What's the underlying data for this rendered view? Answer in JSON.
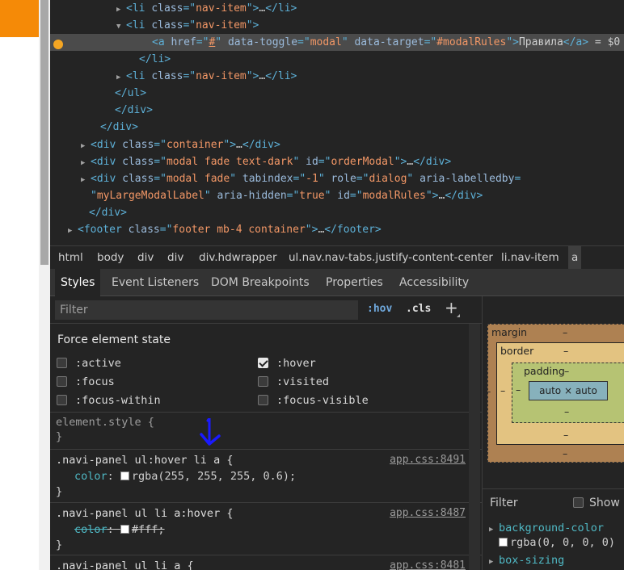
{
  "tree": {
    "lines": [
      {
        "t": "▶",
        "parts": [
          [
            "tag",
            "<li "
          ],
          [
            "attr",
            "class"
          ],
          [
            "tag",
            "=\""
          ],
          [
            "val",
            "nav-item"
          ],
          [
            "tag",
            "\">"
          ],
          [
            "txt",
            "…"
          ],
          [
            "tag",
            "</li>"
          ]
        ]
      },
      {
        "t": "▼",
        "parts": [
          [
            "tag",
            "<li "
          ],
          [
            "attr",
            "class"
          ],
          [
            "tag",
            "=\""
          ],
          [
            "val",
            "nav-item"
          ],
          [
            "tag",
            "\">"
          ]
        ]
      },
      {
        "t": "",
        "parts": [
          [
            "tag",
            "<a "
          ],
          [
            "attr",
            "href"
          ],
          [
            "tag",
            "=\""
          ],
          [
            "val",
            "#"
          ],
          [
            "tag",
            "\" "
          ],
          [
            "attr",
            "data-toggle"
          ],
          [
            "tag",
            "=\""
          ],
          [
            "val",
            "modal"
          ],
          [
            "tag",
            "\" "
          ],
          [
            "attr",
            "data-target"
          ],
          [
            "tag",
            "=\""
          ],
          [
            "val",
            "#modalRules"
          ],
          [
            "tag",
            "\">"
          ],
          [
            "txt",
            "Правила"
          ],
          [
            "tag",
            "</a>"
          ],
          [
            "txt",
            " = $0"
          ]
        ]
      },
      {
        "t": "",
        "parts": [
          [
            "tag",
            "</li>"
          ]
        ]
      },
      {
        "t": "▶",
        "parts": [
          [
            "tag",
            "<li "
          ],
          [
            "attr",
            "class"
          ],
          [
            "tag",
            "=\""
          ],
          [
            "val",
            "nav-item"
          ],
          [
            "tag",
            "\">"
          ],
          [
            "txt",
            "…"
          ],
          [
            "tag",
            "</li>"
          ]
        ]
      },
      {
        "t": "",
        "parts": [
          [
            "tag",
            "</ul>"
          ]
        ]
      },
      {
        "t": "",
        "parts": [
          [
            "tag",
            "</div>"
          ]
        ]
      },
      {
        "t": "",
        "parts": [
          [
            "tag",
            "</div>"
          ]
        ]
      },
      {
        "t": "▶",
        "parts": [
          [
            "tag",
            "<div "
          ],
          [
            "attr",
            "class"
          ],
          [
            "tag",
            "=\""
          ],
          [
            "val",
            "container"
          ],
          [
            "tag",
            "\">"
          ],
          [
            "txt",
            "…"
          ],
          [
            "tag",
            "</div>"
          ]
        ]
      },
      {
        "t": "▶",
        "parts": [
          [
            "tag",
            "<div "
          ],
          [
            "attr",
            "class"
          ],
          [
            "tag",
            "=\""
          ],
          [
            "val",
            "modal fade text-dark"
          ],
          [
            "tag",
            "\" "
          ],
          [
            "attr",
            "id"
          ],
          [
            "tag",
            "=\""
          ],
          [
            "val",
            "orderModal"
          ],
          [
            "tag",
            "\">"
          ],
          [
            "txt",
            "…"
          ],
          [
            "tag",
            "</div>"
          ]
        ]
      },
      {
        "t": "▶",
        "parts": [
          [
            "tag",
            "<div "
          ],
          [
            "attr",
            "class"
          ],
          [
            "tag",
            "=\""
          ],
          [
            "val",
            "modal fade"
          ],
          [
            "tag",
            "\" "
          ],
          [
            "attr",
            "tabindex"
          ],
          [
            "tag",
            "=\""
          ],
          [
            "val",
            "-1"
          ],
          [
            "tag",
            "\" "
          ],
          [
            "attr",
            "role"
          ],
          [
            "tag",
            "=\""
          ],
          [
            "val",
            "dialog"
          ],
          [
            "tag",
            "\" "
          ],
          [
            "attr",
            "aria-labelledby"
          ],
          [
            "tag",
            "="
          ]
        ]
      },
      {
        "t": "",
        "parts": [
          [
            "tag",
            "\""
          ],
          [
            "val",
            "myLargeModalLabel"
          ],
          [
            "tag",
            "\" "
          ],
          [
            "attr",
            "aria-hidden"
          ],
          [
            "tag",
            "=\""
          ],
          [
            "val",
            "true"
          ],
          [
            "tag",
            "\" "
          ],
          [
            "attr",
            "id"
          ],
          [
            "tag",
            "=\""
          ],
          [
            "val",
            "modalRules"
          ],
          [
            "tag",
            "\">"
          ],
          [
            "txt",
            "…"
          ],
          [
            "tag",
            "</div>"
          ]
        ]
      },
      {
        "t": "",
        "parts": [
          [
            "tag",
            "</div>"
          ]
        ]
      },
      {
        "t": "▶",
        "parts": [
          [
            "tag",
            "<footer "
          ],
          [
            "attr",
            "class"
          ],
          [
            "tag",
            "=\""
          ],
          [
            "val",
            "footer mb-4 container"
          ],
          [
            "tag",
            "\">"
          ],
          [
            "txt",
            "…"
          ],
          [
            "tag",
            "</footer>"
          ]
        ]
      }
    ]
  },
  "breadcrumbs": [
    "html",
    "body",
    "div",
    "div",
    "div.hdwrapper",
    "ul.nav.nav-tabs.justify-content-center",
    "li.nav-item",
    "a"
  ],
  "tabs": [
    "Styles",
    "Event Listeners",
    "DOM Breakpoints",
    "Properties",
    "Accessibility"
  ],
  "styles": {
    "filter_placeholder": "Filter",
    "hov": ":hov",
    "cls": ".cls",
    "add": "+",
    "force_title": "Force element state",
    "states": [
      {
        "label": ":active",
        "checked": false
      },
      {
        "label": ":hover",
        "checked": true
      },
      {
        "label": ":focus",
        "checked": false
      },
      {
        "label": ":visited",
        "checked": false
      },
      {
        "label": ":focus-within",
        "checked": false
      },
      {
        "label": ":focus-visible",
        "checked": false
      }
    ],
    "element_style": "element.style {",
    "close": "}",
    "rules": [
      {
        "selector": ".navi-panel ul:hover li a {",
        "source": "app.css:8491",
        "prop": "color",
        "value": "rgba(255, 255, 255, 0.6);",
        "struck": false
      },
      {
        "selector": ".navi-panel ul li a:hover {",
        "source": "app.css:8487",
        "prop": "color",
        "value": "#fff;",
        "struck": true
      },
      {
        "selector": ".navi-panel ul li a {",
        "source": "app.css:8481"
      }
    ]
  },
  "boxmodel": {
    "margin": "margin",
    "border": "border",
    "padding": "padding",
    "content": "auto × auto",
    "dash": "–"
  },
  "computed": {
    "filter_label": "Filter",
    "show_all": "Show all",
    "props": [
      {
        "name": "background-color",
        "value": "rgba(0, 0, 0, 0)"
      },
      {
        "name": "box-sizing"
      }
    ]
  },
  "colors": {
    "page_accent": "#f58a07",
    "annotation_arrow": "#1a1aff"
  }
}
